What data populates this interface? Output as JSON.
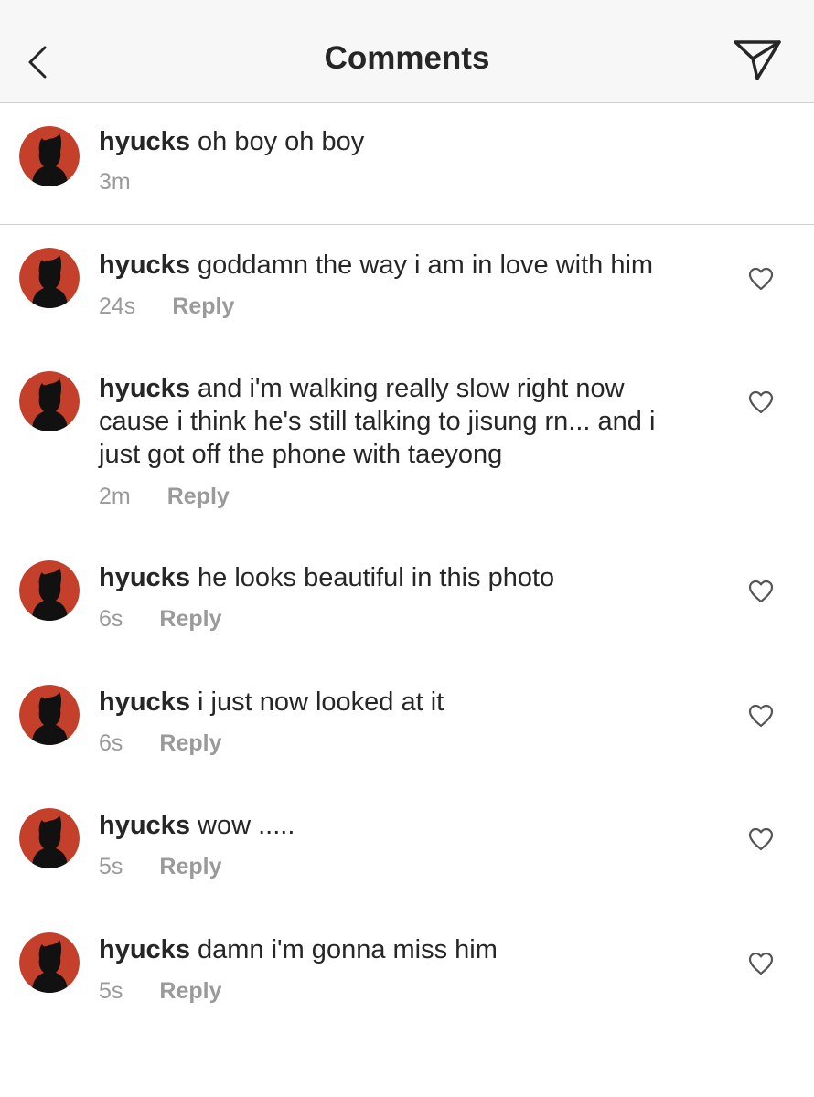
{
  "header": {
    "title": "Comments",
    "back_icon": "chevron-left-icon",
    "share_icon": "paper-plane-icon"
  },
  "caption": {
    "username": "hyucks",
    "text": "oh boy oh boy",
    "time": "3m"
  },
  "comments": [
    {
      "username": "hyucks",
      "text": "goddamn the way i am in love with him",
      "time": "24s",
      "reply": "Reply"
    },
    {
      "username": "hyucks",
      "text_lines": [
        "and i'm walking really slow right now",
        "cause i think he's still talking to jisung rn... and i",
        "just got off the phone with taeyong"
      ],
      "time": "2m",
      "reply": "Reply"
    },
    {
      "username": "hyucks",
      "text": "he looks beautiful in this photo",
      "time": "6s",
      "reply": "Reply"
    },
    {
      "username": "hyucks",
      "text": "i just now looked at it",
      "time": "6s",
      "reply": "Reply"
    },
    {
      "username": "hyucks",
      "text": "wow .....",
      "time": "5s",
      "reply": "Reply"
    },
    {
      "username": "hyucks",
      "text": "damn i'm gonna miss him",
      "time": "5s",
      "reply": "Reply"
    }
  ],
  "colors": {
    "avatar_bg": "#c4402a",
    "avatar_silhouette": "#111111",
    "meta_gray": "#9a9a9a"
  }
}
